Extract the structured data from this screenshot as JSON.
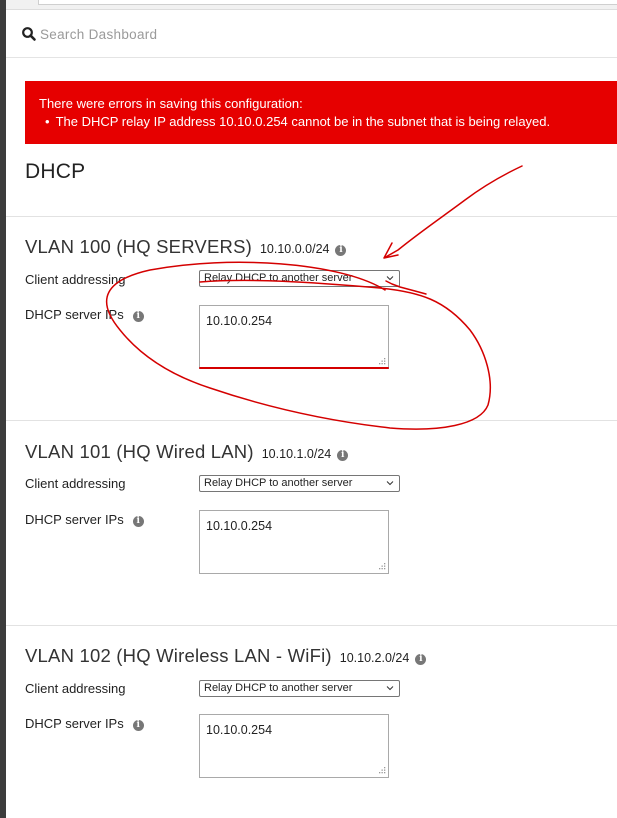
{
  "search": {
    "placeholder": "Search Dashboard"
  },
  "error": {
    "heading": "There were errors in saving this configuration:",
    "items": [
      "The DHCP relay IP address 10.10.0.254 cannot be in the subnet that is being relayed."
    ]
  },
  "page": {
    "title": "DHCP"
  },
  "vlans": [
    {
      "name": "VLAN 100 (HQ SERVERS)",
      "subnet": "10.10.0.0/24",
      "client_addressing_label": "Client addressing",
      "client_addressing_value": "Relay DHCP to another server",
      "dhcp_servers_label": "DHCP server IPs",
      "dhcp_servers_value": "10.10.0.254"
    },
    {
      "name": "VLAN 101 (HQ Wired LAN)",
      "subnet": "10.10.1.0/24",
      "client_addressing_label": "Client addressing",
      "client_addressing_value": "Relay DHCP to another server",
      "dhcp_servers_label": "DHCP server IPs",
      "dhcp_servers_value": "10.10.0.254"
    },
    {
      "name": "VLAN 102 (HQ Wireless LAN - WiFi)",
      "subnet": "10.10.2.0/24",
      "client_addressing_label": "Client addressing",
      "client_addressing_value": "Relay DHCP to another server",
      "dhcp_servers_label": "DHCP server IPs",
      "dhcp_servers_value": "10.10.0.254"
    }
  ],
  "icons": {
    "search": "search-icon",
    "info": "info-icon",
    "dropdown": "chevron-down-icon",
    "resize": "resize-grip-icon"
  },
  "colors": {
    "error_background": "#e60000",
    "annotation": "#d40000"
  }
}
